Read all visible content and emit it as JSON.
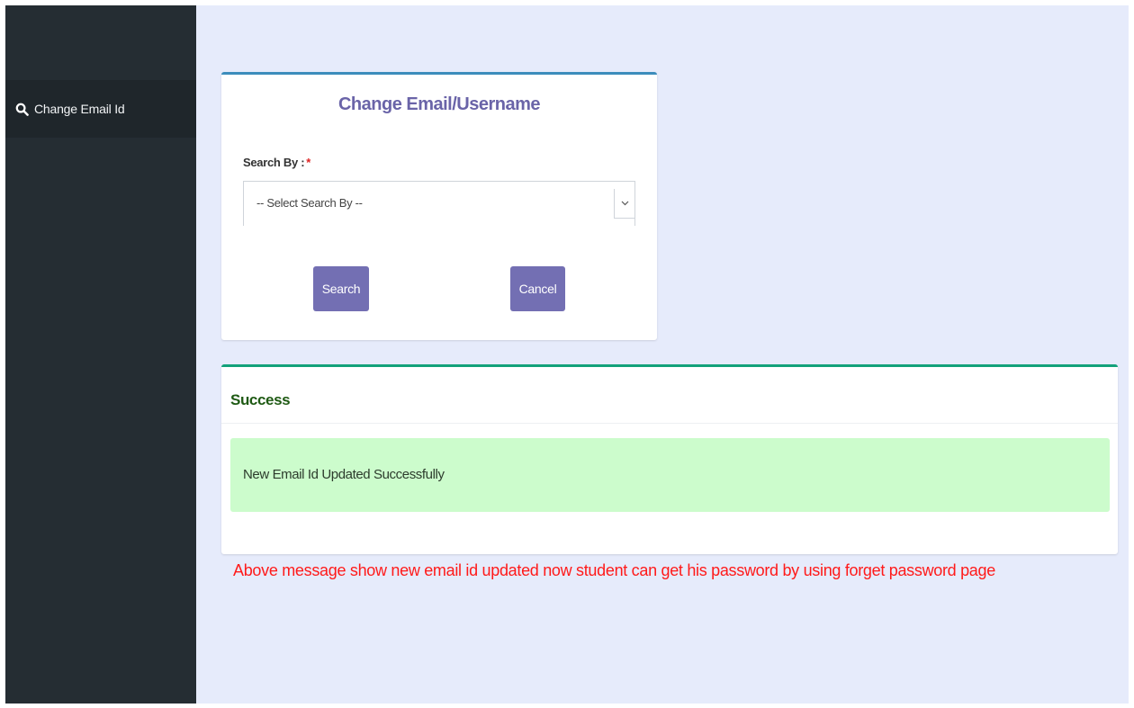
{
  "sidebar": {
    "items": [
      {
        "label": "Change Email Id",
        "icon": "search-icon"
      }
    ]
  },
  "form_card": {
    "title": "Change Email/Username",
    "search_by_label": "Search By :",
    "required_mark": "*",
    "select": {
      "selected": "-- Select Search By --"
    },
    "search_button": "Search",
    "cancel_button": "Cancel"
  },
  "success_card": {
    "title": "Success",
    "message": "New Email Id Updated Successfully"
  },
  "annotation": "Above message show new email id updated now student can get his password by using forget password page",
  "colors": {
    "sidebar_bg": "#252d33",
    "page_bg": "#e6ebfb",
    "form_accent": "#3c8dbc",
    "success_accent": "#13a17a",
    "button": "#736fb3",
    "title": "#6a64a8",
    "alert_bg": "#ccfccc",
    "annotation_text": "#ff1a1a"
  }
}
